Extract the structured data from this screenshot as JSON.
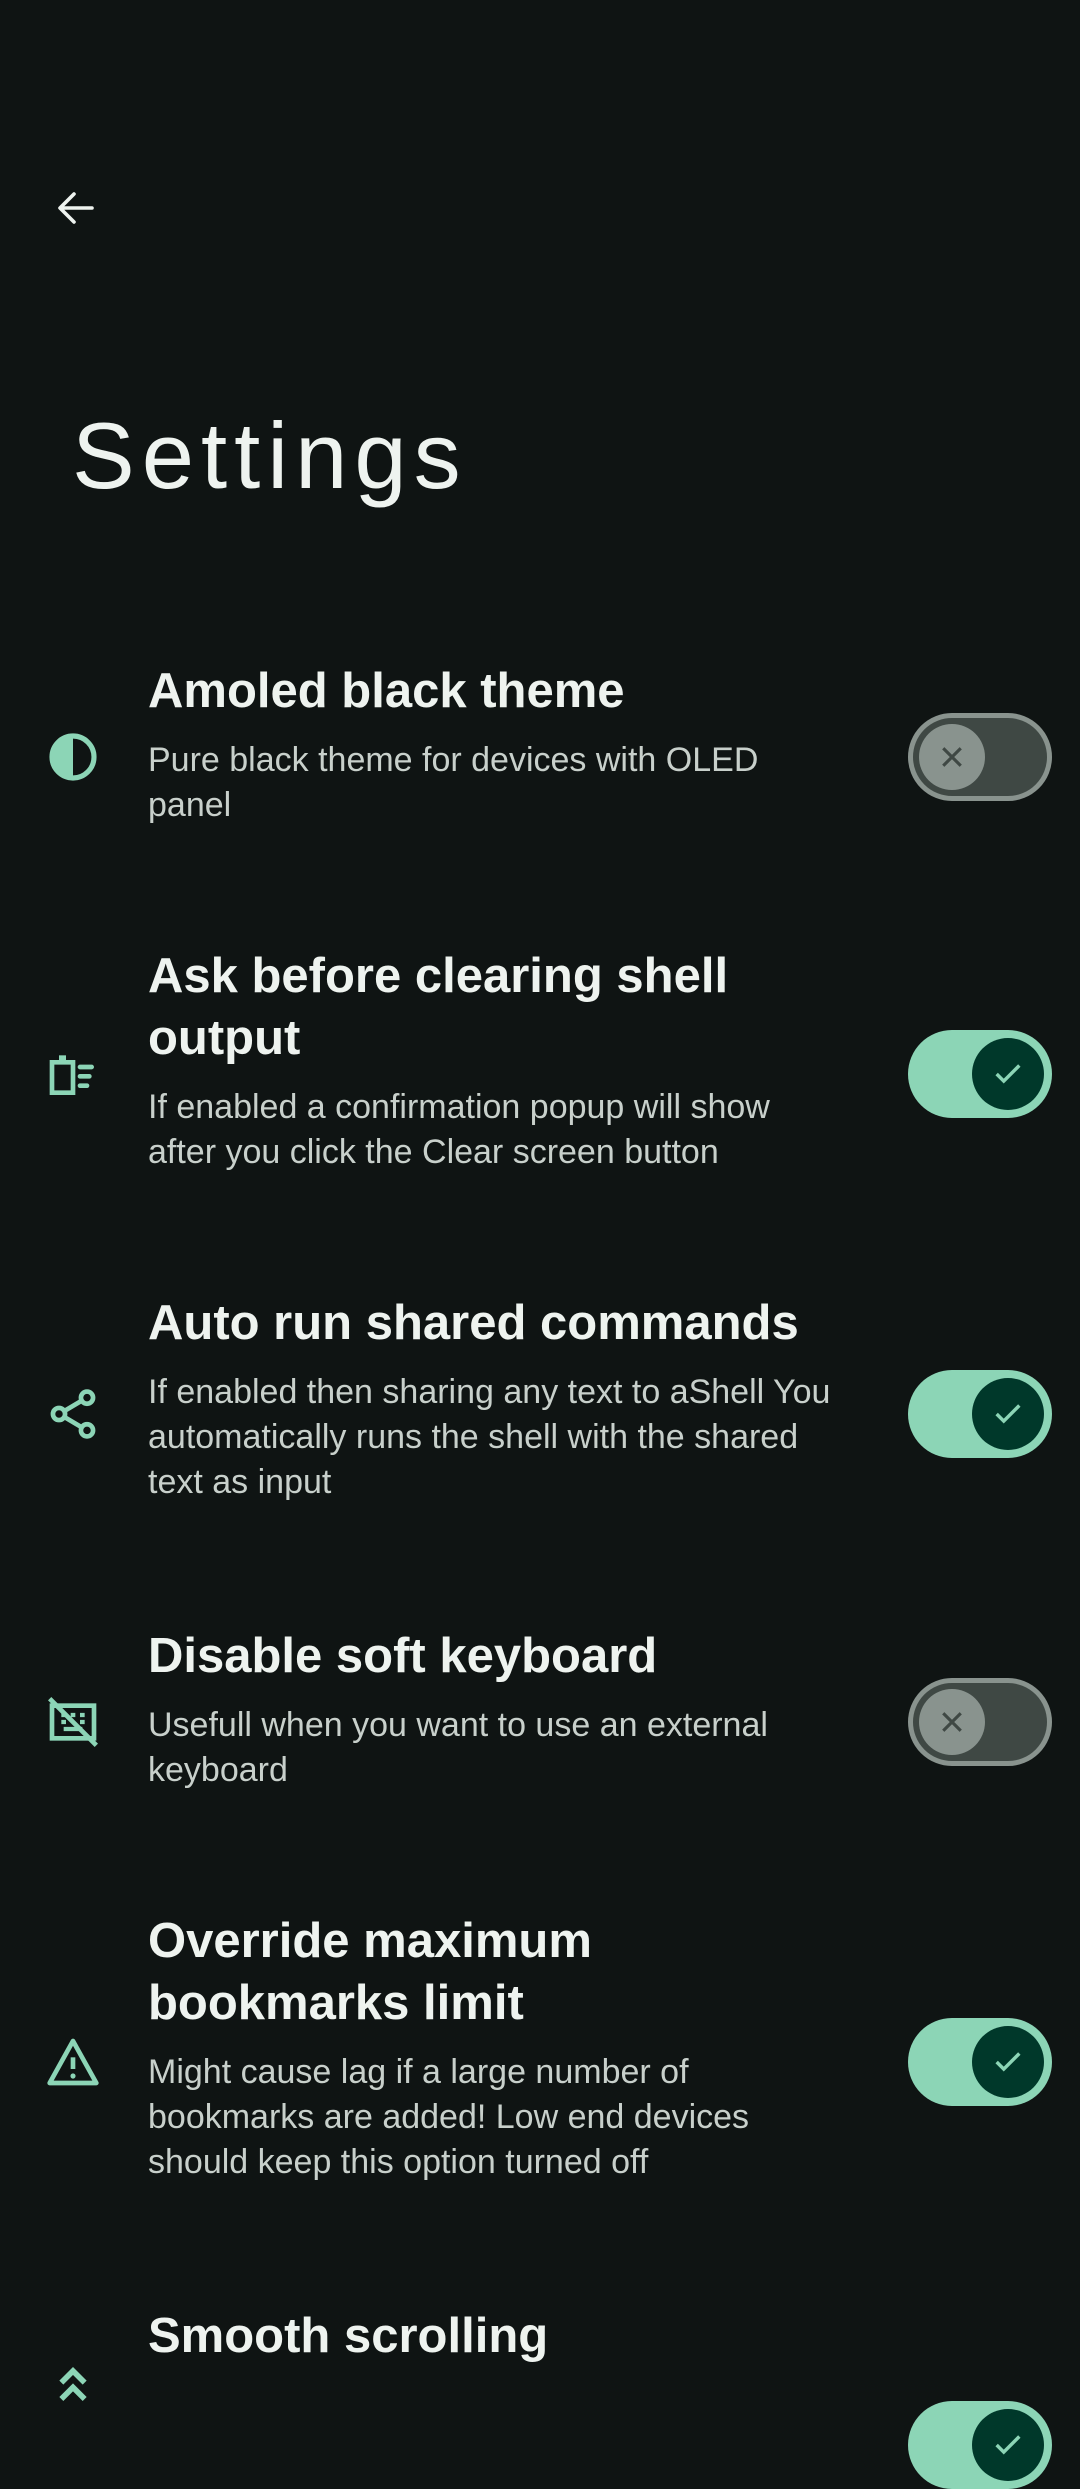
{
  "header": {
    "back_label": "Back",
    "title": "Settings"
  },
  "colors": {
    "background": "#0f1413",
    "accent": "#8cd5b6",
    "thumb_on": "#00382a",
    "off_track": "#3f4844",
    "off_thumb": "#89938e"
  },
  "settings": [
    {
      "title": "Amoled black theme",
      "description": "Pure black theme for devices with OLED panel",
      "enabled": false,
      "icon": "contrast-icon"
    },
    {
      "title": "Ask before clearing shell output",
      "description": "If enabled a confirmation popup will show after you click the Clear screen button",
      "enabled": true,
      "icon": "clear-all-icon"
    },
    {
      "title": "Auto run shared commands",
      "description": "If enabled then sharing any text to aShell You automatically runs the shell with the shared text as input",
      "enabled": true,
      "icon": "share-icon"
    },
    {
      "title": "Disable soft keyboard",
      "description": "Usefull when you want to use an external keyboard",
      "enabled": false,
      "icon": "keyboard-off-icon"
    },
    {
      "title": "Override maximum bookmarks limit",
      "description": "Might cause lag if a large number of bookmarks are added! Low end devices should keep this option turned off",
      "enabled": true,
      "icon": "warning-icon"
    },
    {
      "title": "Smooth scrolling",
      "description": "",
      "enabled": true,
      "icon": "double-chevron-up-icon"
    }
  ]
}
